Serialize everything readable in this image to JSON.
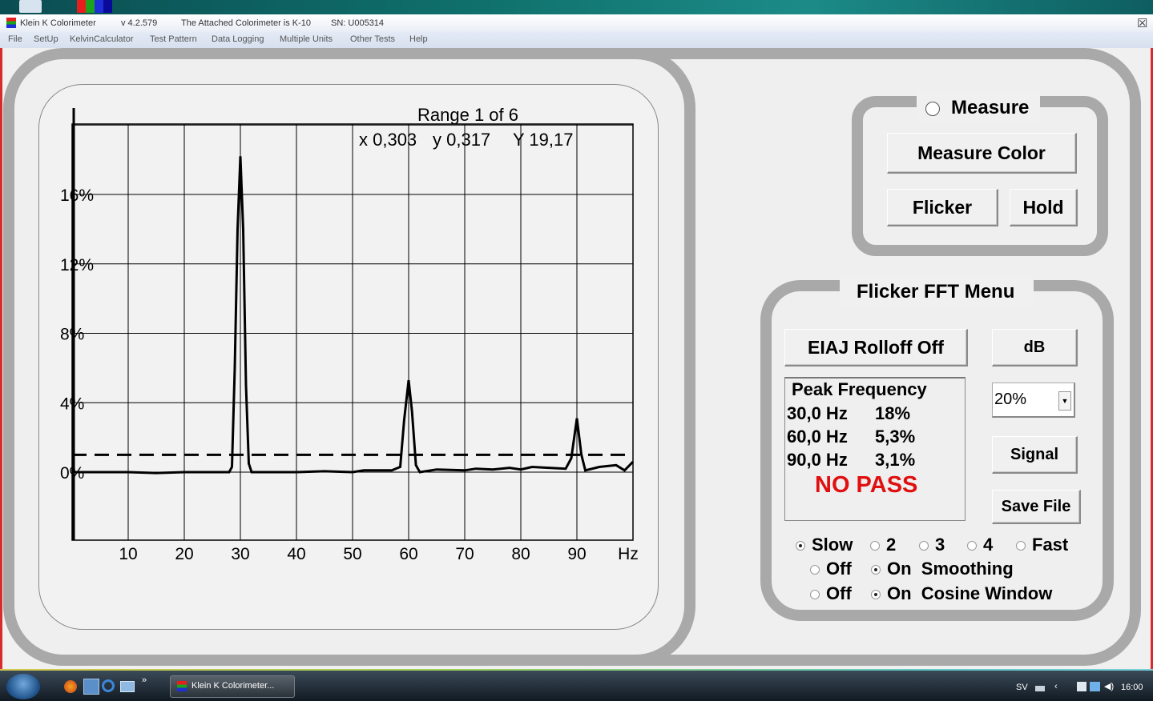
{
  "window": {
    "app_name": "Klein  K Colorimeter",
    "version": "v 4.2.579",
    "attached": "The Attached Colorimeter is K-10",
    "serial": "SN: U005314",
    "close_glyph": "☒"
  },
  "menu": [
    "File",
    "SetUp",
    "KelvinCalculator",
    "Test Pattern",
    "Data Logging",
    "Multiple Units",
    "Other Tests",
    "Help"
  ],
  "chart_header": {
    "range": "Range 1 of 6",
    "x": "x 0,303",
    "y": "y 0,317",
    "Y": "Y 19,17"
  },
  "chart_data": {
    "type": "line",
    "xlabel": "Hz",
    "xlim": [
      0,
      100
    ],
    "ylim": [
      0,
      20
    ],
    "y_ticks": [
      "0%",
      "4%",
      "8%",
      "12%",
      "16%"
    ],
    "y_tick_values": [
      0,
      4,
      8,
      12,
      16
    ],
    "x_tick_labels": [
      "10",
      "20",
      "30",
      "40",
      "50",
      "60",
      "70",
      "80",
      "90",
      "Hz"
    ],
    "x_tick_values": [
      10,
      20,
      30,
      40,
      50,
      60,
      70,
      80,
      90,
      100
    ],
    "threshold": 1.0,
    "series": [
      {
        "values": [
          [
            0,
            0.0
          ],
          [
            5,
            0.0
          ],
          [
            10,
            0.0
          ],
          [
            15,
            -0.05
          ],
          [
            20,
            0.0
          ],
          [
            25,
            0.0
          ],
          [
            28,
            0.0
          ],
          [
            28.5,
            0.3
          ],
          [
            29,
            6
          ],
          [
            29.5,
            14
          ],
          [
            30,
            18.2
          ],
          [
            30.5,
            14
          ],
          [
            31,
            5
          ],
          [
            31.5,
            0.5
          ],
          [
            32,
            0.0
          ],
          [
            40,
            0.0
          ],
          [
            45,
            0.05
          ],
          [
            50,
            0.0
          ],
          [
            52,
            0.1
          ],
          [
            57,
            0.1
          ],
          [
            58.5,
            0.3
          ],
          [
            59.2,
            3
          ],
          [
            60,
            5.3
          ],
          [
            60.6,
            3.5
          ],
          [
            61.3,
            0.4
          ],
          [
            62,
            0.0
          ],
          [
            65,
            0.15
          ],
          [
            70,
            0.1
          ],
          [
            72,
            0.2
          ],
          [
            75,
            0.15
          ],
          [
            78,
            0.25
          ],
          [
            80,
            0.15
          ],
          [
            82,
            0.3
          ],
          [
            85,
            0.25
          ],
          [
            88,
            0.2
          ],
          [
            89,
            0.8
          ],
          [
            90,
            3.1
          ],
          [
            90.8,
            1.0
          ],
          [
            91.5,
            0.1
          ],
          [
            94,
            0.3
          ],
          [
            97,
            0.4
          ],
          [
            98.5,
            0.1
          ],
          [
            100,
            0.6
          ]
        ]
      }
    ]
  },
  "measure_panel": {
    "title": "Measure",
    "measure_color": "Measure Color",
    "flicker": "Flicker",
    "hold": "Hold"
  },
  "fft_panel": {
    "title": "Flicker FFT Menu",
    "eiaj": "EIAJ Rolloff Off",
    "db": "dB",
    "peak_title": "Peak Frequency",
    "peaks": [
      {
        "freq": "30,0 Hz",
        "pct": "18%"
      },
      {
        "freq": "60,0 Hz",
        "pct": "5,3%"
      },
      {
        "freq": "90,0 Hz",
        "pct": "3,1%"
      }
    ],
    "result": "NO PASS",
    "result_color": "#e01010",
    "scale_value": "20%",
    "signal": "Signal",
    "save_file": "Save File",
    "speed_options": [
      "Slow",
      "2",
      "3",
      "4",
      "Fast"
    ],
    "speed_selected": "Slow",
    "smoothing_off": "Off",
    "smoothing_on": "On  Smoothing",
    "cosine_off": "Off",
    "cosine_on": "On  Cosine Window"
  },
  "taskbar": {
    "window_label": "Klein  K Colorimeter...",
    "lang": "SV",
    "time": "16:00"
  }
}
